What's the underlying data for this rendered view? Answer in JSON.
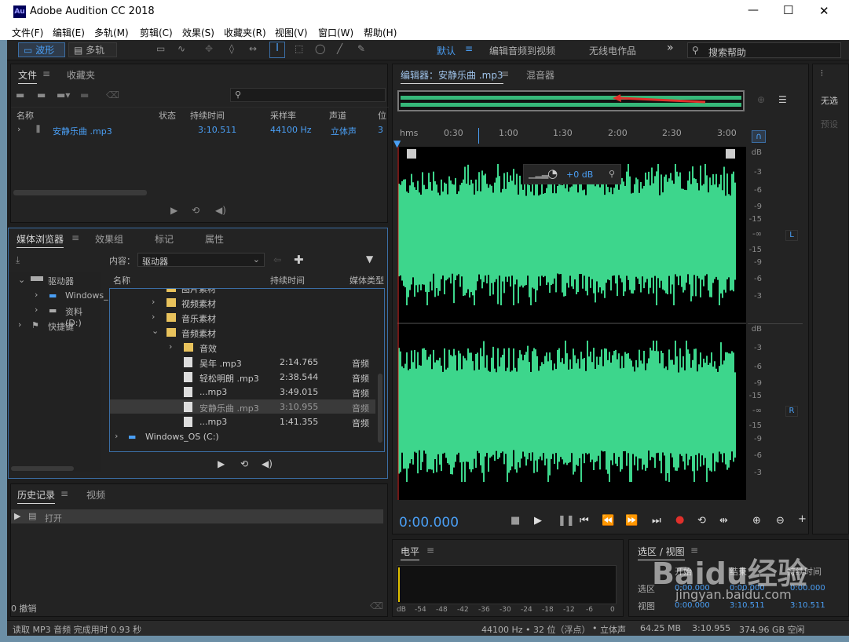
{
  "title_bar": {
    "app_icon": "Au",
    "title": "Adobe Audition CC 2018",
    "minimize": "—",
    "maximize": "☐",
    "close": "✕"
  },
  "menu": [
    "文件(F)",
    "编辑(E)",
    "多轨(M)",
    "剪辑(C)",
    "效果(S)",
    "收藏夹(R)",
    "视图(V)",
    "窗口(W)",
    "帮助(H)"
  ],
  "toolbar": {
    "waveform": "波形",
    "multitrack": "多轨",
    "workspaces": [
      "默认",
      "编辑音频到视频",
      "无线电作品"
    ],
    "more": "»",
    "search_placeholder": "搜索帮助"
  },
  "files_panel": {
    "tabs": [
      "文件",
      "收藏夹"
    ],
    "columns": [
      "名称",
      "状态",
      "持续时间",
      "采样率",
      "声道",
      "位"
    ],
    "row": {
      "name": "安静乐曲 .mp3",
      "duration": "3:10.511",
      "rate": "44100 Hz",
      "channels": "立体声",
      "bit": "3"
    }
  },
  "media_browser": {
    "tabs": [
      "媒体浏览器",
      "效果组",
      "标记",
      "属性"
    ],
    "content_label": "内容：",
    "content_value": "驱动器",
    "tree": [
      {
        "label": "驱动器"
      },
      {
        "label": "Windows_"
      },
      {
        "label": "资料 (D:)"
      },
      {
        "label": "快捷键"
      }
    ],
    "columns": [
      "名称",
      "持续时间",
      "媒体类型"
    ],
    "partial_folder": "图片素材",
    "folders": [
      "视频素材",
      "音乐素材",
      "音频素材",
      "音效"
    ],
    "files": [
      {
        "name": "吴年 .mp3",
        "duration": "2:14.765",
        "type": "音频"
      },
      {
        "name": "轻松明朗 .mp3",
        "duration": "2:38.544",
        "type": "音频"
      },
      {
        "name": "...mp3",
        "duration": "3:49.015",
        "type": "音频"
      },
      {
        "name": "安静乐曲 .mp3",
        "duration": "3:10.955",
        "type": "音频"
      },
      {
        "name": "...mp3",
        "duration": "1:41.355",
        "type": "音频"
      }
    ],
    "drive_c": "Windows_OS (C:)"
  },
  "history": {
    "tabs": [
      "历史记录",
      "视频"
    ],
    "item": "打开",
    "undo": "0 撤销"
  },
  "editor": {
    "tab": "编辑器：安静乐曲 .mp3",
    "mixer_tab": "混音器",
    "ruler": [
      "hms",
      "0:30",
      "1:00",
      "1:30",
      "2:00",
      "2:30",
      "3:00"
    ],
    "volume": "+0 dB",
    "db_labels": [
      "dB",
      "-3",
      "-6",
      "-9",
      "-15",
      "-∞",
      "-15",
      "-9",
      "-6",
      "-3"
    ],
    "channel_l": "L",
    "channel_r": "R",
    "time": "0:00.000",
    "wave_color": "#3dd68c"
  },
  "right_panel": {
    "label1": "无选",
    "label2": "预设"
  },
  "level_meter": {
    "title": "电平",
    "scale": [
      "dB",
      "-54",
      "-48",
      "-42",
      "-36",
      "-30",
      "-24",
      "-18",
      "-12",
      "-6",
      "0"
    ]
  },
  "selection_view": {
    "title": "选区 / 视图",
    "cols": [
      "开始",
      "结束",
      "持续时间"
    ],
    "rows": [
      {
        "label": "选区",
        "start": "0:00.000",
        "end": "0:00.000",
        "dur": "0:00.000"
      },
      {
        "label": "视图",
        "start": "0:00.000",
        "end": "3:10.511",
        "dur": "3:10.511"
      }
    ]
  },
  "status": {
    "left": "读取 MP3 音频 完成用时 0.93 秒",
    "rate": "44100 Hz • 32 位（浮点）",
    "ch": "立体声",
    "mem": "64.25 MB",
    "dur": "3:10.955",
    "free": "374.96 GB 空闲"
  },
  "watermark": {
    "brand": "Baidu经验",
    "url": "jingyan.baidu.com"
  }
}
